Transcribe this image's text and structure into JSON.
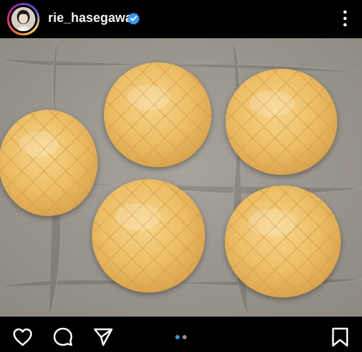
{
  "header": {
    "username": "rie_hasegawa",
    "verified_icon": "verified-badge-icon",
    "more_icon": "more-vertical-icon"
  },
  "post": {
    "image_subject": "melon-pan-buns",
    "carousel": {
      "count": 2,
      "active_index": 0
    }
  },
  "actions": {
    "like_icon": "heart-icon",
    "comment_icon": "comment-icon",
    "share_icon": "send-icon",
    "save_icon": "bookmark-icon"
  },
  "colors": {
    "background": "#000000",
    "text": "#f4f4f4",
    "verified_blue": "#3897f0",
    "dot_active": "#3897f0",
    "dot_inactive": "#8e8e8e"
  }
}
